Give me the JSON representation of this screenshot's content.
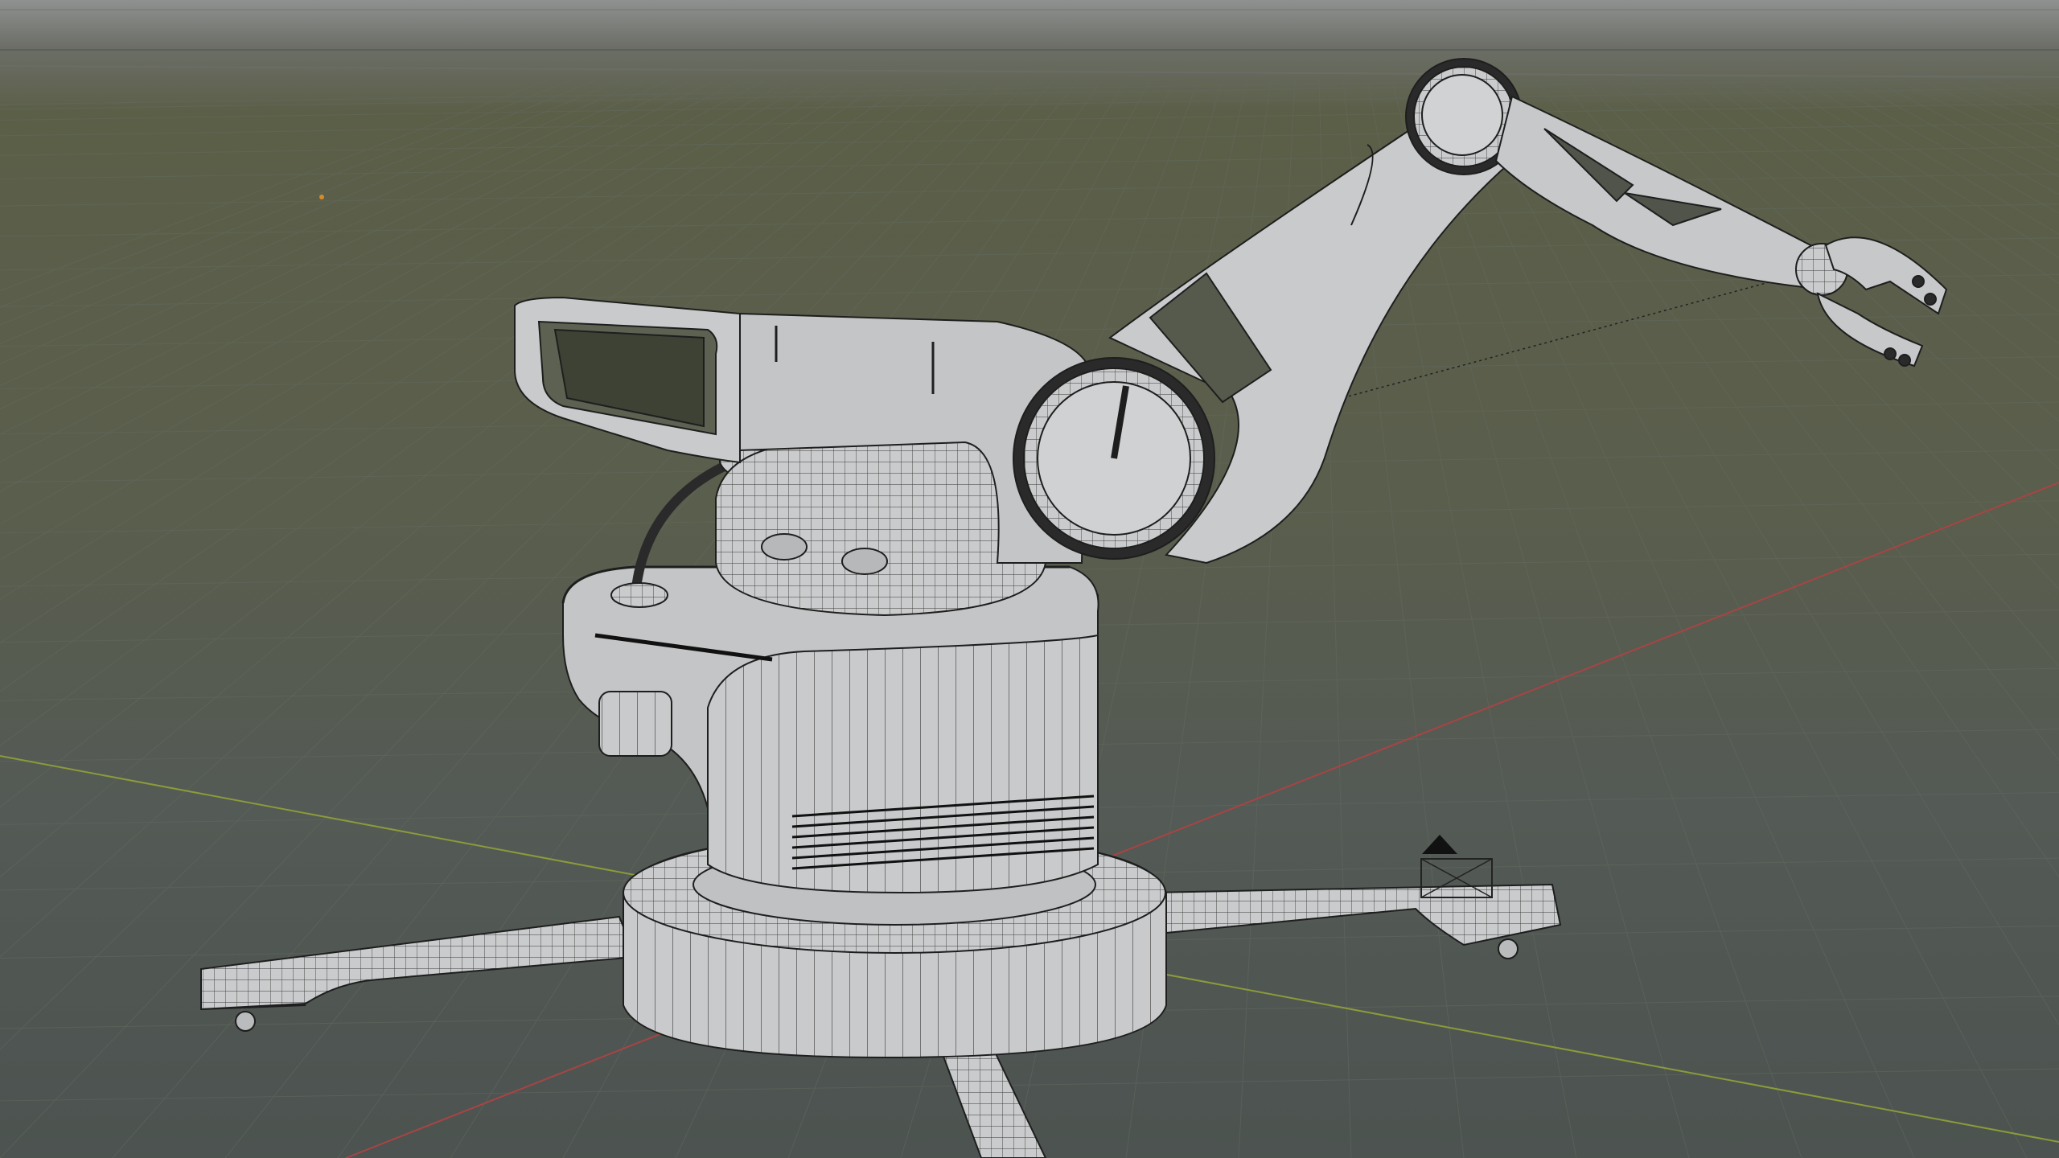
{
  "viewport": {
    "mode": "3d-viewport",
    "shading": "wireframe-overlay",
    "model": "robot-arm",
    "icons": {
      "light_gizmo": "light-gizmo-icon",
      "origin_marker": "origin-dot-icon"
    }
  },
  "colors": {
    "background_top": "#8f9190",
    "background_mid": "#5a5e4c",
    "background_bottom": "#4c5350",
    "grid": "#666b60",
    "x_axis": "#b04a4a",
    "y_axis": "#8a9a3a",
    "model_fill": "#c9cbcc",
    "model_shade": "#a3a6a8",
    "wire": "#1c1c1c"
  }
}
